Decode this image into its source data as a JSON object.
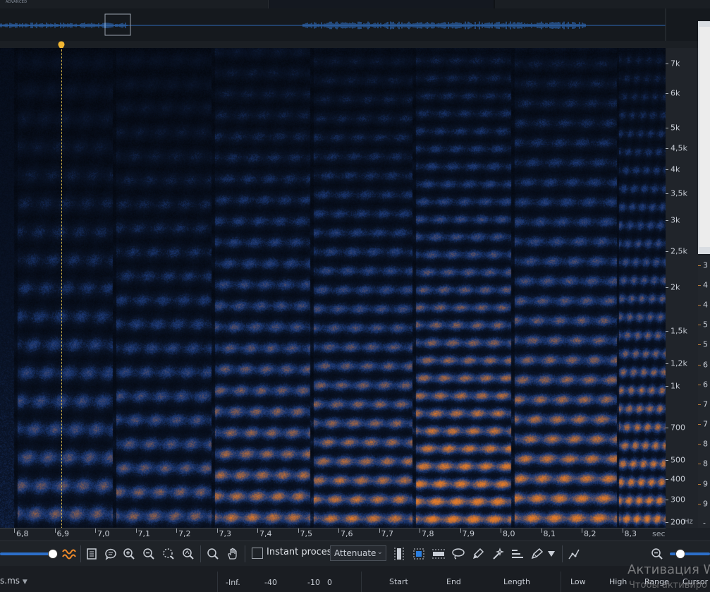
{
  "app": {
    "edition_badge": "ADVANCED"
  },
  "overview": {
    "waveform_color": "#2f6ab8"
  },
  "spectrogram": {
    "low_color": "#0a1428",
    "mid_color": "#1c3a78",
    "high_color": "#e07a2a"
  },
  "frequency_axis": {
    "labels": [
      "7k",
      "6k",
      "5k",
      "4,5k",
      "4k",
      "3,5k",
      "3k",
      "2,5k",
      "2k",
      "1,5k",
      "1,2k",
      "1k",
      "700",
      "500",
      "400",
      "300",
      "200"
    ],
    "unit": "Hz"
  },
  "time_axis": {
    "labels": [
      "6,8",
      "6,9",
      "7,0",
      "7,1",
      "7,2",
      "7,3",
      "7,4",
      "7,5",
      "7,6",
      "7,7",
      "7,8",
      "7,9",
      "8,0",
      "8,1",
      "8,2",
      "8,3"
    ],
    "unit": "sec"
  },
  "scale_strip": {
    "labels": [
      "3",
      "4",
      "4",
      "5",
      "5",
      "6",
      "6",
      "7",
      "7",
      "8",
      "8",
      "9",
      "9"
    ],
    "bottom_label": "-"
  },
  "toolbar": {
    "instant_process_label": "Instant process",
    "mode_select_value": "Attenuate",
    "zoom_level": 0.93,
    "right_zoom_level": 0.25
  },
  "status_bar": {
    "file_name": "s.ms",
    "meter_labels": [
      "-Inf.",
      "-40",
      "-10",
      "0"
    ],
    "columns": [
      "Start",
      "End",
      "Length",
      "Low",
      "High",
      "Range",
      "Cursor"
    ]
  },
  "activation": {
    "title": "Активация W",
    "subtitle": "Чтобы активиро"
  }
}
